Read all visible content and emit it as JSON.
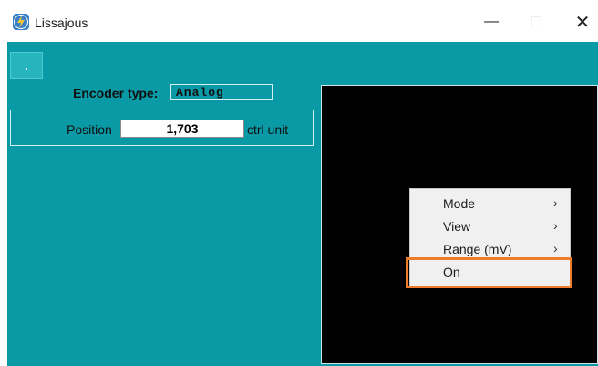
{
  "window": {
    "title": "Lissajous",
    "min_glyph": "—",
    "max_glyph": "☐",
    "close_glyph": "✕"
  },
  "toolbar": {
    "button_label": "."
  },
  "encoder": {
    "label": "Encoder type:",
    "value": "Analog"
  },
  "position": {
    "label": "Position",
    "value": "1,703",
    "unit": "ctrl unit"
  },
  "context_menu": {
    "items": [
      {
        "label": "Mode",
        "has_submenu": true,
        "arrow": "›"
      },
      {
        "label": "View",
        "has_submenu": true,
        "arrow": "›"
      },
      {
        "label": "Range (mV)",
        "has_submenu": true,
        "arrow": "›"
      },
      {
        "label": "On",
        "has_submenu": false,
        "highlighted": true
      }
    ]
  },
  "colors": {
    "client_bg": "#0a9aa5",
    "highlight": "#ee7d2a",
    "scope_bg": "#000000"
  },
  "icons": {
    "app": "lissajous-app-icon",
    "minimize": "minimize-icon",
    "maximize": "maximize-icon",
    "close": "close-icon",
    "submenu": "chevron-right-icon"
  }
}
